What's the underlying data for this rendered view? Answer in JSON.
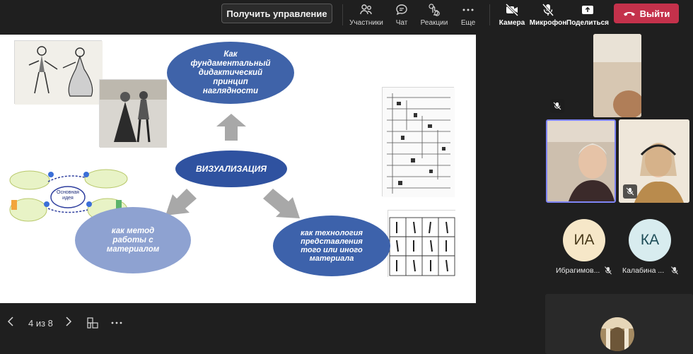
{
  "toolbar": {
    "take_control_label": "Получить управление",
    "items": [
      {
        "label": "Участники",
        "icon": "participants-icon"
      },
      {
        "label": "Чат",
        "icon": "chat-icon"
      },
      {
        "label": "Реакции",
        "icon": "reactions-icon"
      },
      {
        "label": "Еще",
        "icon": "more-icon"
      },
      {
        "label": "Камера",
        "icon": "camera-off-icon"
      },
      {
        "label": "Микрофон",
        "icon": "mic-off-icon"
      },
      {
        "label": "Поделиться",
        "icon": "share-icon"
      }
    ],
    "leave_label": "Выйти",
    "leave_color": "#c4314b"
  },
  "slide": {
    "top_bubble": "Как фундаментальный дидактический принцип наглядности",
    "center_bubble": "ВИЗУАЛИЗАЦИЯ",
    "left_bubble": "как метод работы с материалом",
    "right_bubble": "как технология представления того или иного материала",
    "mindmap_center": "Основная идея"
  },
  "slide_nav": {
    "page_indicator": "4 из 8"
  },
  "participants": [
    {
      "initials": "ИА",
      "name": "Ибрагимов...",
      "avatar_color": "#f6e7c8",
      "text_color": "#4a3b1c"
    },
    {
      "initials": "КА",
      "name": "Калабина ...",
      "avatar_color": "#d8ecef",
      "text_color": "#1d4c57"
    }
  ]
}
